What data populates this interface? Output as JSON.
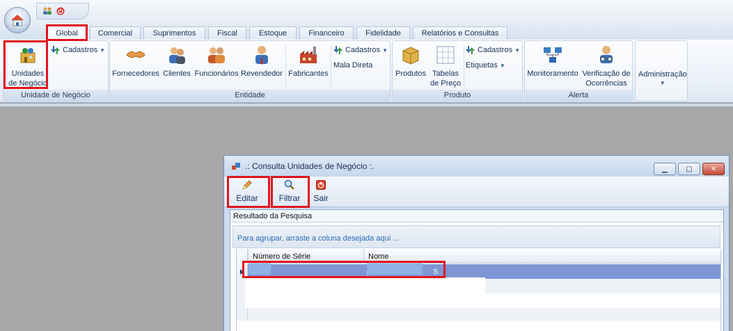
{
  "qat": {
    "icons": [
      "users-icon",
      "power-icon"
    ]
  },
  "tabs": [
    {
      "label": "Global",
      "active": true
    },
    {
      "label": "Comercial"
    },
    {
      "label": "Suprimentos"
    },
    {
      "label": "Fiscal"
    },
    {
      "label": "Estoque"
    },
    {
      "label": "Financeiro"
    },
    {
      "label": "Fidelidade"
    },
    {
      "label": "Relatórios e Consultas"
    }
  ],
  "ribbon": {
    "unidade": {
      "group_label": "Unidade de Negócio",
      "unidades_line1": "Unidades",
      "unidades_line2": "de Negócio",
      "cadastros": "Cadastros"
    },
    "entidade": {
      "group_label": "Entidade",
      "fornecedores": "Fornecedores",
      "clientes": "Clientes",
      "funcionarios": "Funcionários",
      "revendedor": "Revendedor",
      "fabricantes": "Fabricantes",
      "cadastros": "Cadastros",
      "mala_direta": "Mala Direta"
    },
    "produto": {
      "group_label": "Produto",
      "produtos": "Produtos",
      "tabelas_line1": "Tabelas",
      "tabelas_line2": "de Preço",
      "cadastros": "Cadastros",
      "etiquetas": "Etiquetas"
    },
    "alerta": {
      "group_label": "Alerta",
      "monitoramento": "Monitoramento",
      "verificacao_line1": "Verificação de",
      "verificacao_line2": "Ocorrências"
    },
    "administracao": {
      "label": "Administração"
    }
  },
  "dialog": {
    "title": ".: Consulta Unidades de Negócio :.",
    "toolbar": {
      "editar": "Editar",
      "filtrar": "Filtrar",
      "sair": "Sair"
    },
    "panel_caption": "Resultado da Pesquisa",
    "group_hint": "Para agrupar, arraste a coluna desejada aqui ...",
    "columns": [
      "Número de Série",
      "Nome"
    ],
    "rows": [
      {
        "numero": ":",
        "nome": "(",
        "nome_end": "S"
      }
    ]
  },
  "colors": {
    "highlight": "#e0141e",
    "selected_row": "#7f96d4",
    "ribbon_text": "#15305a",
    "link_text": "#2a6ab6"
  }
}
